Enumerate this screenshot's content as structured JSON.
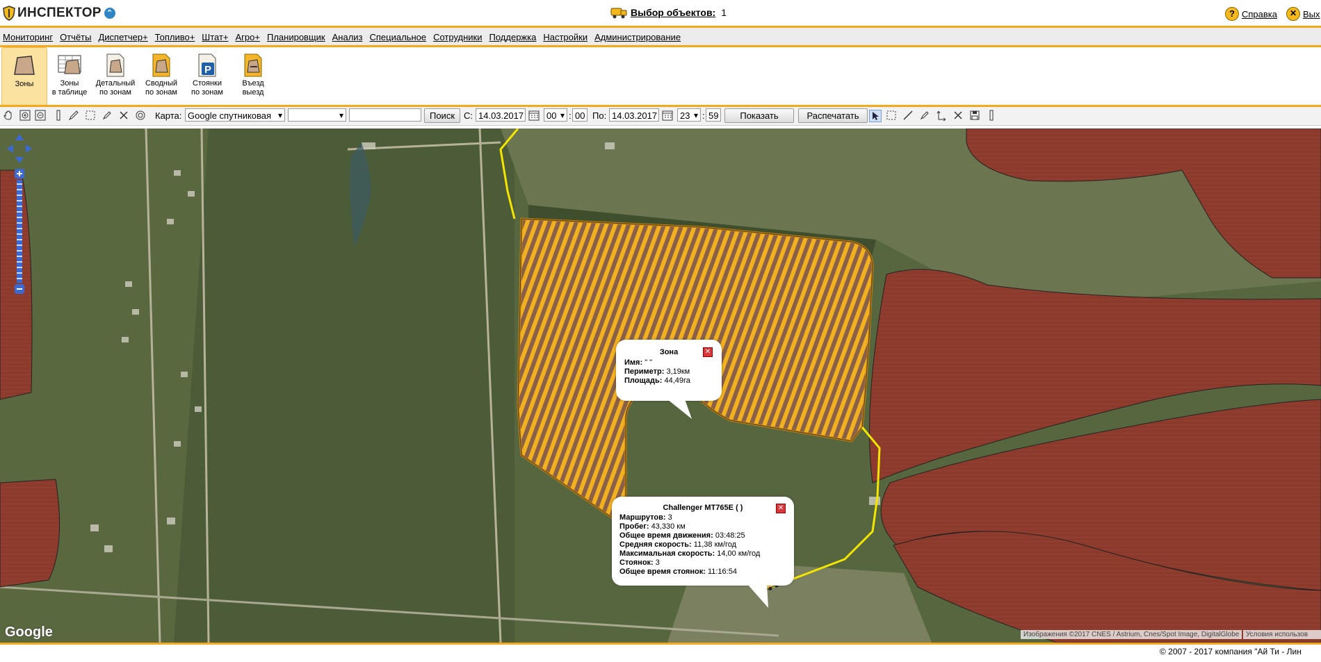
{
  "header": {
    "logo_text": "ИНСПЕКТОР",
    "object_selection_label": "Выбор объектов:",
    "object_selection_count": "1",
    "help_label": "Справка",
    "exit_label": "Вых"
  },
  "menu": {
    "items": [
      "Мониторинг",
      "Отчёты",
      "Диспетчер+",
      "Топливо+",
      "Штат+",
      "Агро+",
      "Планировщик",
      "Анализ",
      "Специальное",
      "Сотрудники",
      "Поддержка",
      "Настройки",
      "Администрирование"
    ]
  },
  "ribbon": {
    "tools": [
      {
        "label": "Зоны",
        "icon": "zone-icon"
      },
      {
        "label": "Зоны\nв таблице",
        "icon": "zone-table-icon"
      },
      {
        "label": "Детальный\nпо зонам",
        "icon": "zone-detail-icon"
      },
      {
        "label": "Сводный\nпо зонам",
        "icon": "zone-summary-icon"
      },
      {
        "label": "Стоянки\nпо зонам",
        "icon": "parking-icon"
      },
      {
        "label": "Въезд\nвыезд",
        "icon": "entry-exit-icon"
      }
    ]
  },
  "toolbar": {
    "map_label": "Карта:",
    "map_type": "Google спутниковая",
    "layer_select": "",
    "search_value": "",
    "search_button": "Поиск",
    "from_label": "С:",
    "from_date": "14.03.2017",
    "from_hour": "00",
    "from_minute": "00",
    "to_label": "По:",
    "to_date": "14.03.2017",
    "to_hour": "23",
    "to_minute": "59",
    "show_button": "Показать",
    "print_button": "Распечатать"
  },
  "map": {
    "google_logo": "Google",
    "attribution": "Изображения ©2017 CNES / Astrium, Cnes/Spot Image, DigitalGlobe",
    "terms": "Условия использов"
  },
  "zone_popup": {
    "title": "Зона",
    "name_label": "Имя:",
    "name_value": "\"        \"",
    "perimeter_label": "Периметр:",
    "perimeter_value": "3,19км",
    "area_label": "Площадь:",
    "area_value": "44,49га"
  },
  "vehicle_popup": {
    "title": "Challenger MT765E (              )",
    "rows": [
      {
        "label": "Маршрутов:",
        "value": "3"
      },
      {
        "label": "Пробег:",
        "value": "43,330 км"
      },
      {
        "label": "Общее время движения:",
        "value": "03:48:25"
      },
      {
        "label": "Средняя скорость:",
        "value": "11,38 км/год"
      },
      {
        "label": "Максимальная скорость:",
        "value": "14,00 км/год"
      },
      {
        "label": "Стоянок:",
        "value": "3"
      },
      {
        "label": "Общее время стоянок:",
        "value": "11:16:54"
      }
    ]
  },
  "footer": {
    "copyright": "© 2007 - 2017 компания \"Ай Ти - Лин"
  },
  "colors": {
    "accent": "#f5a81a",
    "zone_fill": "#f0b020",
    "track": "#f5e600",
    "field_brown": "#8c3a2c"
  }
}
